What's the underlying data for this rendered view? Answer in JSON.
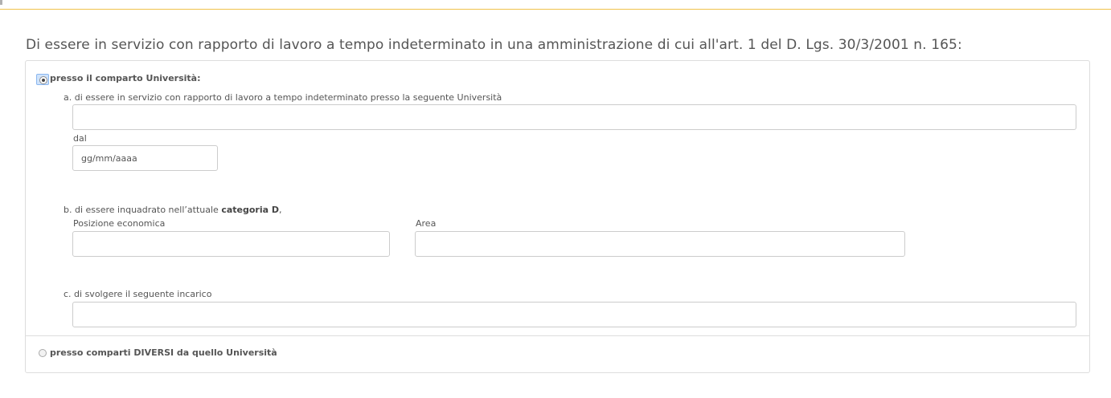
{
  "section": {
    "title": "Di essere in servizio con rapporto di lavoro a tempo indeterminato in una amministrazione di cui all'art. 1 del D. Lgs. 30/3/2001 n. 165:"
  },
  "option_universita": {
    "label": "presso il comparto Università:",
    "selected": true,
    "a": {
      "text": "a. di essere in servizio con rapporto di lavoro a tempo indeterminato presso la seguente Università",
      "value": "",
      "dal_label": "dal",
      "dal_placeholder": "gg/mm/aaaa"
    },
    "b": {
      "text_prefix": "b. di essere inquadrato nell’attuale ",
      "text_bold": "categoria D",
      "text_suffix": ",",
      "posizione_label": "Posizione economica",
      "posizione_value": "",
      "area_label": "Area",
      "area_value": ""
    },
    "c": {
      "text": "c. di svolgere il seguente incarico",
      "value": ""
    }
  },
  "option_diversi": {
    "label": "presso comparti DIVERSI da quello Università",
    "selected": false
  }
}
